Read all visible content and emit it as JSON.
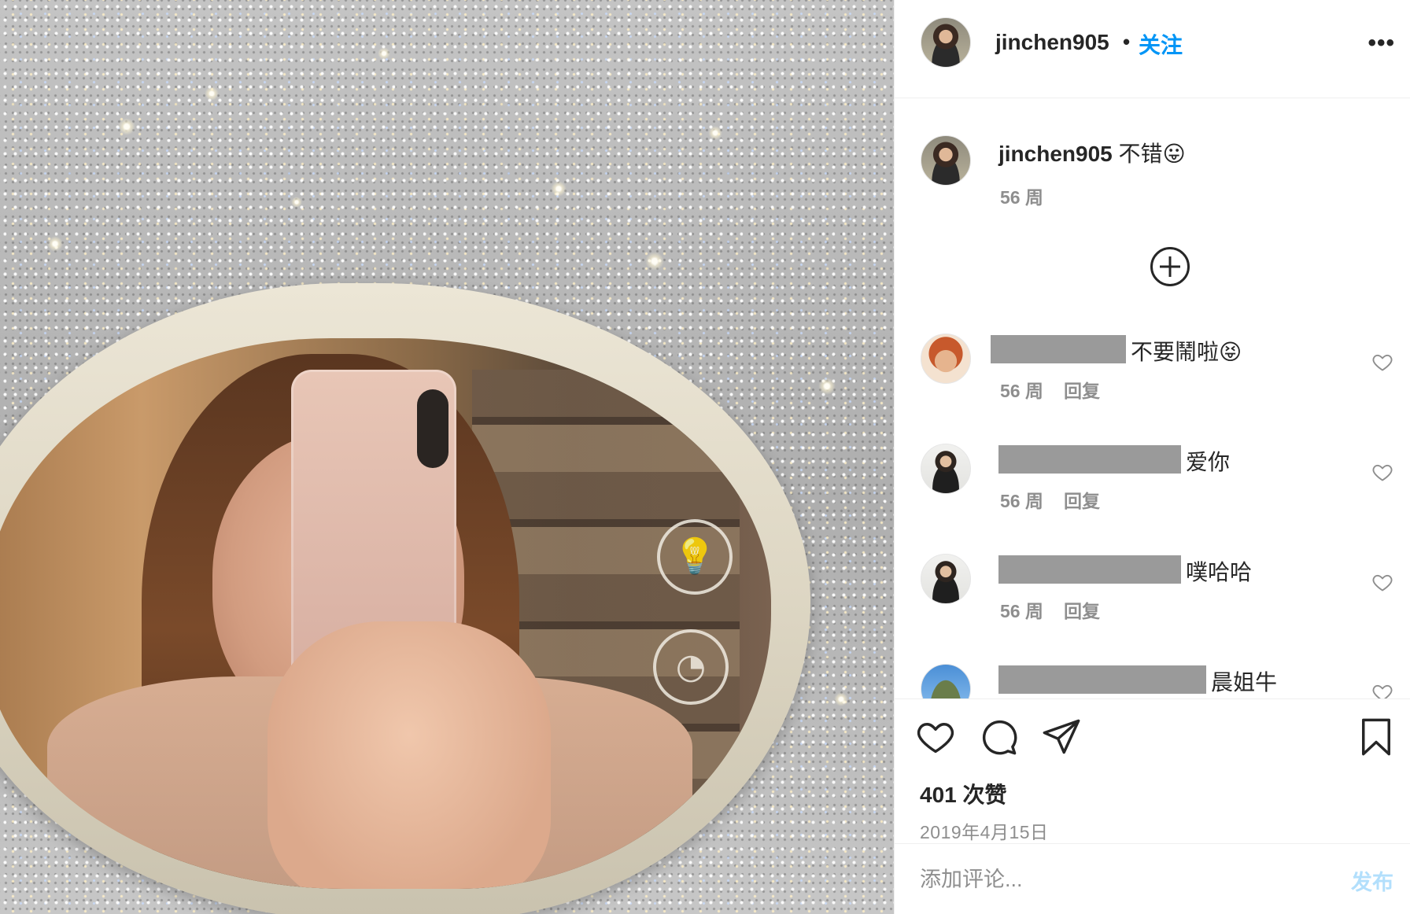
{
  "post": {
    "author": "jinchen905",
    "dot": "•",
    "follow_label": "关注",
    "more_label": "•••"
  },
  "caption": {
    "username": "jinchen905",
    "text": "不错😛",
    "time": "56 周"
  },
  "comments": [
    {
      "text": "不要鬧啦😝",
      "time": "56 周",
      "reply": "回复"
    },
    {
      "text": "爱你",
      "time": "56 周",
      "reply": "回复"
    },
    {
      "text": "噗哈哈",
      "time": "56 周",
      "reply": "回复"
    },
    {
      "text": "晨姐牛",
      "time": "",
      "reply": ""
    }
  ],
  "stats": {
    "likes": "401 次赞",
    "date": "2019年4月15日"
  },
  "composer": {
    "placeholder": "添加评论...",
    "post_label": "发布"
  },
  "icons": {
    "like": "heart-icon",
    "comment": "speech-bubble-icon",
    "share": "paper-plane-icon",
    "save": "bookmark-icon",
    "load_more": "plus-circle-icon",
    "comment_like": "heart-outline-icon"
  },
  "colors": {
    "accent": "#0095f6",
    "post_disabled": "#b2dffc",
    "muted": "#8e8e8e",
    "text": "#262626"
  }
}
